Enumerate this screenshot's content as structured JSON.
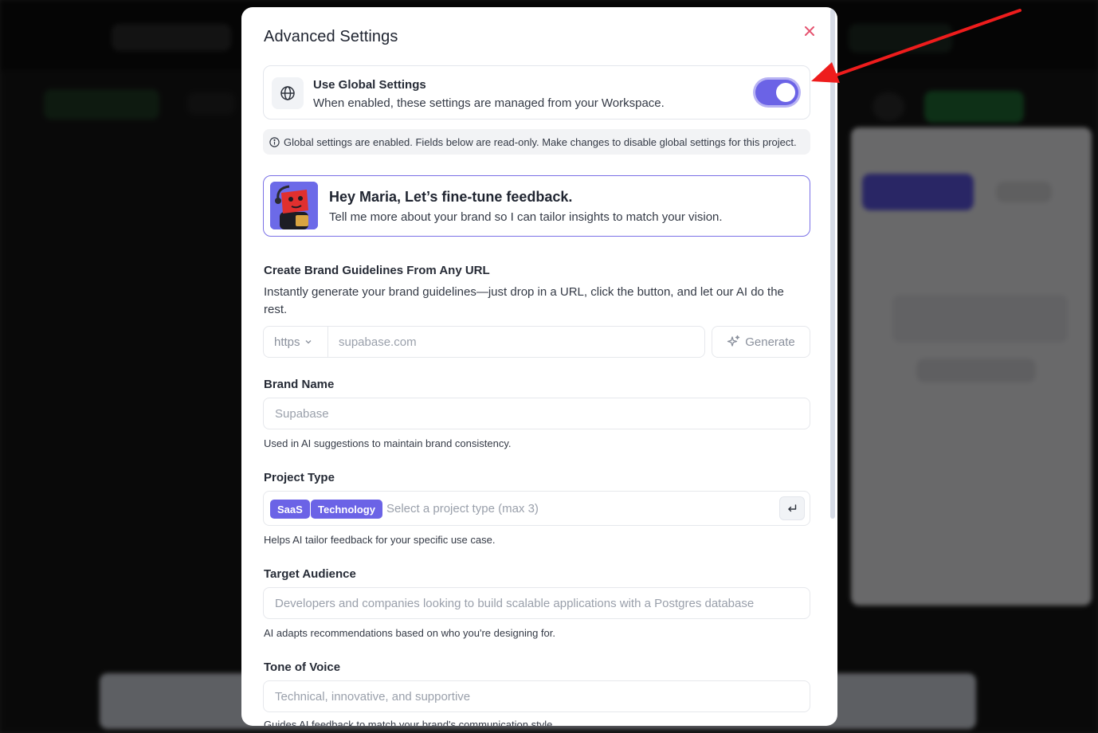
{
  "modal": {
    "title": "Advanced Settings",
    "close_icon": "close-icon"
  },
  "global_settings": {
    "icon": "globe-icon",
    "title": "Use Global Settings",
    "description": "When enabled, these settings are managed from your Workspace.",
    "enabled": true,
    "info": "Global settings are enabled. Fields below are read-only. Make changes to disable global settings for this project.",
    "info_icon": "info-icon"
  },
  "greeting": {
    "title": "Hey Maria, Let’s fine-tune feedback.",
    "subtitle": "Tell me more about your brand so I can tailor insights to match your vision."
  },
  "brand_guidelines": {
    "label": "Create Brand Guidelines From Any URL",
    "description": "Instantly generate your brand guidelines—just drop in a URL, click the button, and let our AI do the rest.",
    "protocol": "https",
    "url_placeholder": "supabase.com",
    "generate_label": "Generate"
  },
  "brand_name": {
    "label": "Brand Name",
    "placeholder": "Supabase",
    "help": "Used in AI suggestions to maintain brand consistency."
  },
  "project_type": {
    "label": "Project Type",
    "tags": [
      "SaaS",
      "Technology"
    ],
    "placeholder": "Select a project type (max 3)",
    "help": "Helps AI tailor feedback for your specific use case."
  },
  "target_audience": {
    "label": "Target Audience",
    "placeholder": "Developers and companies looking to build scalable applications with a Postgres database",
    "help": "AI adapts recommendations based on who you're designing for."
  },
  "tone_of_voice": {
    "label": "Tone of Voice",
    "placeholder": "Technical, innovative, and supportive",
    "help": "Guides AI feedback to match your brand's communication style."
  },
  "colors": {
    "accent": "#6b63e6",
    "close": "#e5536f",
    "annotation": "#ee1c1c"
  }
}
